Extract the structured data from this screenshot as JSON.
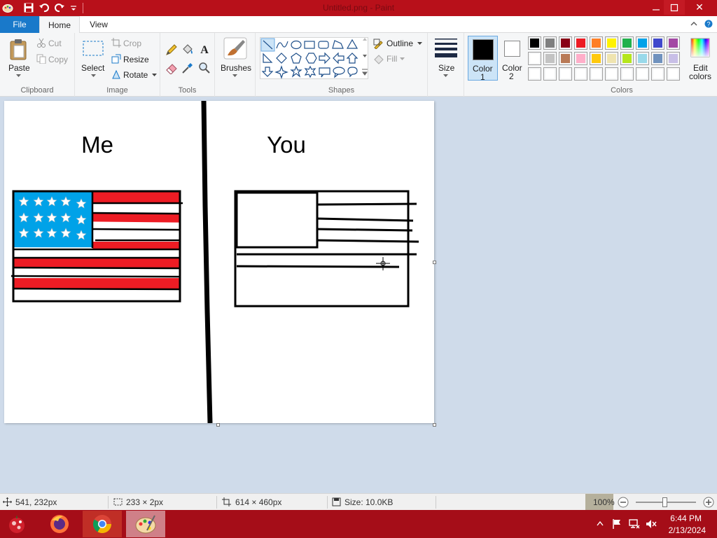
{
  "window": {
    "title": "Untitled.png - Paint",
    "minimize_icon": "minimize-icon",
    "maximize_icon": "maximize-icon",
    "close_glyph": "✕"
  },
  "tabs": {
    "file": "File",
    "home": "Home",
    "view": "View"
  },
  "ribbon": {
    "clipboard": {
      "paste": "Paste",
      "cut": "Cut",
      "copy": "Copy",
      "label": "Clipboard"
    },
    "image": {
      "select": "Select",
      "crop": "Crop",
      "resize": "Resize",
      "rotate": "Rotate",
      "label": "Image"
    },
    "tools": {
      "label": "Tools"
    },
    "brushes": {
      "label": "Brushes"
    },
    "shapes": {
      "outline": "Outline",
      "fill": "Fill",
      "label": "Shapes"
    },
    "size": {
      "label": "Size"
    },
    "color1": {
      "line1": "Color",
      "line2": "1"
    },
    "color2": {
      "line1": "Color",
      "line2": "2"
    },
    "colors": {
      "label": "Colors",
      "edit1": "Edit",
      "edit2": "colors",
      "row1": [
        "#000000",
        "#7f7f7f",
        "#880015",
        "#ed1c24",
        "#ff7f27",
        "#fff200",
        "#22b14c",
        "#00a2e8",
        "#3f48cc",
        "#a349a4"
      ],
      "row2": [
        "#ffffff",
        "#c3c3c3",
        "#b97a57",
        "#ffaec9",
        "#ffc90e",
        "#efe4b0",
        "#b5e61d",
        "#99d9ea",
        "#7092be",
        "#c8bfe7"
      ],
      "row3": [
        "#ffffff",
        "#ffffff",
        "#ffffff",
        "#ffffff",
        "#ffffff",
        "#ffffff",
        "#ffffff",
        "#ffffff",
        "#ffffff",
        "#ffffff"
      ]
    }
  },
  "canvas": {
    "left_heading": "Me",
    "right_heading": "You"
  },
  "status": {
    "cursor_pos": "541, 232px",
    "selection_size": "233 × 2px",
    "canvas_size": "614 × 460px",
    "file_size": "Size: 10.0KB",
    "zoom": "100%"
  },
  "taskbar": {
    "time": "6:44 PM",
    "date": "2/13/2024"
  }
}
